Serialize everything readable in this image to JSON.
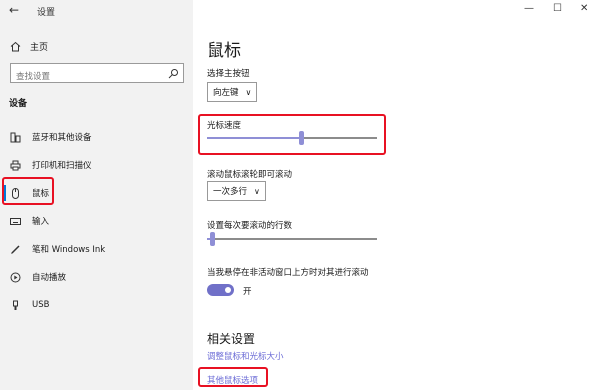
{
  "sidebar": {
    "title": "设置",
    "home_label": "主页",
    "search_placeholder": "查找设置",
    "section_title": "设备",
    "items": [
      {
        "label": "蓝牙和其他设备"
      },
      {
        "label": "打印机和扫描仪"
      },
      {
        "label": "鼠标"
      },
      {
        "label": "输入"
      },
      {
        "label": "笔和 Windows Ink"
      },
      {
        "label": "自动播放"
      },
      {
        "label": "USB"
      }
    ]
  },
  "main": {
    "page_title": "鼠标",
    "primary_button": {
      "label": "选择主按钮",
      "value": "向左键"
    },
    "cursor_speed": {
      "label": "光标速度",
      "value": 0.55
    },
    "wheel_scroll": {
      "label": "滚动鼠标滚轮即可滚动",
      "value": "一次多行"
    },
    "lines_per_scroll": {
      "label": "设置每次要滚动的行数",
      "value": 0.03
    },
    "inactive_scroll": {
      "label": "当我悬停在非活动窗口上方时对其进行滚动",
      "state_label": "开"
    },
    "related": {
      "title": "相关设置",
      "links": [
        "调整鼠标和光标大小",
        "其他鼠标选项"
      ]
    }
  },
  "colors": {
    "accent": "#0078d7",
    "slider": "#8f8fd6",
    "link": "#6b6bd6",
    "highlight": "#e81123"
  }
}
